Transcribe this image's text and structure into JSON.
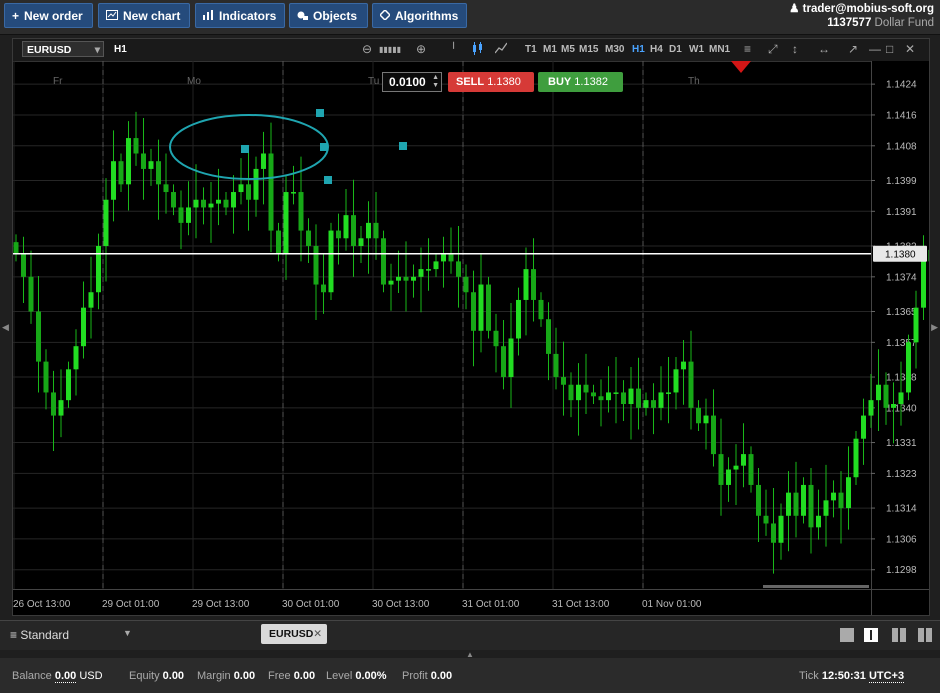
{
  "toolbar": {
    "new_order": "New order",
    "new_chart": "New chart",
    "indicators": "Indicators",
    "objects": "Objects",
    "algorithms": "Algorithms"
  },
  "account": {
    "user": "trader@mobius-soft.org",
    "number": "1137577",
    "name": "Dollar Fund"
  },
  "chart": {
    "symbol": "EURUSD",
    "timeframe": "H1",
    "timeframes": [
      "T1",
      "M1",
      "M5",
      "M15",
      "M30",
      "H1",
      "H4",
      "D1",
      "W1",
      "MN1"
    ],
    "active_timeframe": "H1",
    "quantity": "0.0100",
    "sell_label": "SELL",
    "sell_price": "1.1380",
    "buy_label": "BUY",
    "buy_price": "1.1382",
    "current_price": "1.1380",
    "up_color": "#1fd21f",
    "down_color": "#1fd21f",
    "price_line_color": "#ffffff",
    "accent_sell": "#d63a37",
    "accent_buy": "#3f9e3e"
  },
  "chart_data": {
    "type": "candlestick",
    "y_ticks": [
      "1.1424",
      "1.1416",
      "1.1408",
      "1.1399",
      "1.1391",
      "1.1382",
      "1.1374",
      "1.1365",
      "1.1357",
      "1.1348",
      "1.1340",
      "1.1331",
      "1.1323",
      "1.1314",
      "1.1306",
      "1.1298"
    ],
    "ylim": [
      1.1293,
      1.143
    ],
    "x_labels": [
      "26 Oct 13:00",
      "29 Oct 01:00",
      "29 Oct 13:00",
      "30 Oct 01:00",
      "30 Oct 13:00",
      "31 Oct 01:00",
      "31 Oct 13:00",
      "01 Nov 01:00"
    ],
    "day_labels": [
      "Fr",
      "Mo",
      "Tu",
      "We",
      "Th"
    ],
    "grid": true,
    "closes": [
      1.138,
      1.1374,
      1.1365,
      1.1352,
      1.1344,
      1.1338,
      1.1342,
      1.135,
      1.1356,
      1.1366,
      1.137,
      1.1382,
      1.1394,
      1.1404,
      1.1398,
      1.141,
      1.1406,
      1.1402,
      1.1404,
      1.1398,
      1.1396,
      1.1392,
      1.1388,
      1.1392,
      1.1394,
      1.1392,
      1.1393,
      1.1394,
      1.1392,
      1.1396,
      1.1398,
      1.1394,
      1.1402,
      1.1406,
      1.1386,
      1.138,
      1.1396,
      1.1396,
      1.1386,
      1.1382,
      1.1372,
      1.137,
      1.1386,
      1.1384,
      1.139,
      1.1382,
      1.1384,
      1.1388,
      1.1384,
      1.1372,
      1.1373,
      1.1374,
      1.1373,
      1.1374,
      1.1376,
      1.1376,
      1.1378,
      1.138,
      1.1378,
      1.1374,
      1.137,
      1.136,
      1.1372,
      1.136,
      1.1356,
      1.1348,
      1.1358,
      1.1368,
      1.1376,
      1.1368,
      1.1363,
      1.1354,
      1.1348,
      1.1346,
      1.1342,
      1.1346,
      1.1344,
      1.1343,
      1.1342,
      1.1344,
      1.1344,
      1.1341,
      1.1345,
      1.134,
      1.1342,
      1.134,
      1.1344,
      1.1344,
      1.135,
      1.1352,
      1.134,
      1.1336,
      1.1338,
      1.1328,
      1.132,
      1.1324,
      1.1325,
      1.1328,
      1.132,
      1.1312,
      1.131,
      1.1305,
      1.1312,
      1.1318,
      1.1312,
      1.132,
      1.1309,
      1.1312,
      1.1316,
      1.1318,
      1.1314,
      1.1322,
      1.1332,
      1.1338,
      1.1342,
      1.1346,
      1.134,
      1.1341,
      1.1344,
      1.1357,
      1.1366,
      1.1378,
      1.1381
    ]
  },
  "workspace": {
    "name": "Standard",
    "tab": "EURUSD"
  },
  "status": {
    "balance_label": "Balance",
    "balance": "0.00",
    "currency": "USD",
    "equity_label": "Equity",
    "equity": "0.00",
    "margin_label": "Margin",
    "margin": "0.00",
    "free_label": "Free",
    "free": "0.00",
    "level_label": "Level",
    "level": "0.00%",
    "profit_label": "Profit",
    "profit": "0.00",
    "tick_label": "Tick",
    "time": "12:50:31",
    "timezone": "UTC+3"
  }
}
